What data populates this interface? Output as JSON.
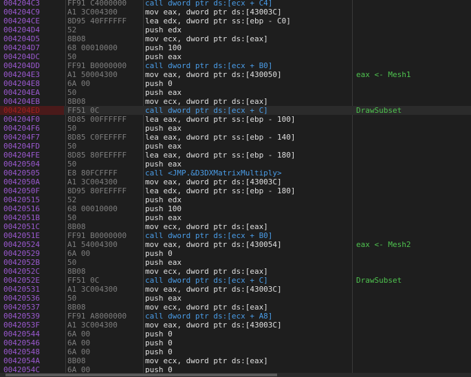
{
  "rows": [
    {
      "addr": "004204C3",
      "bytes": "FF91 C4000000",
      "ins": "call dword ptr ds:[ecx + C4]",
      "comment": "",
      "kind": "call"
    },
    {
      "addr": "004204C9",
      "bytes": "A1 3C004300",
      "ins": "mov eax, dword ptr ds:[43003C]",
      "comment": "",
      "kind": ""
    },
    {
      "addr": "004204CE",
      "bytes": "8D95 40FFFFFF",
      "ins": "lea edx, dword ptr ss:[ebp - C0]",
      "comment": "",
      "kind": ""
    },
    {
      "addr": "004204D4",
      "bytes": "52",
      "ins": "push edx",
      "comment": "",
      "kind": ""
    },
    {
      "addr": "004204D5",
      "bytes": "8B08",
      "ins": "mov ecx, dword ptr ds:[eax]",
      "comment": "",
      "kind": ""
    },
    {
      "addr": "004204D7",
      "bytes": "68 00010000",
      "ins": "push 100",
      "comment": "",
      "kind": ""
    },
    {
      "addr": "004204DC",
      "bytes": "50",
      "ins": "push eax",
      "comment": "",
      "kind": ""
    },
    {
      "addr": "004204DD",
      "bytes": "FF91 B0000000",
      "ins": "call dword ptr ds:[ecx + B0]",
      "comment": "",
      "kind": "call"
    },
    {
      "addr": "004204E3",
      "bytes": "A1 50004300",
      "ins": "mov eax, dword ptr ds:[430050]",
      "comment": "eax <- Mesh1",
      "kind": ""
    },
    {
      "addr": "004204E8",
      "bytes": "6A 00",
      "ins": "push 0",
      "comment": "",
      "kind": ""
    },
    {
      "addr": "004204EA",
      "bytes": "50",
      "ins": "push eax",
      "comment": "",
      "kind": ""
    },
    {
      "addr": "004204EB",
      "bytes": "8B08",
      "ins": "mov ecx, dword ptr ds:[eax]",
      "comment": "",
      "kind": ""
    },
    {
      "addr": "004204ED",
      "bytes": "FF51 0C",
      "ins": "call dword ptr ds:[ecx + C]",
      "comment": "DrawSubset",
      "kind": "call current"
    },
    {
      "addr": "004204F0",
      "bytes": "8D85 00FFFFFF",
      "ins": "lea eax, dword ptr ss:[ebp - 100]",
      "comment": "",
      "kind": ""
    },
    {
      "addr": "004204F6",
      "bytes": "50",
      "ins": "push eax",
      "comment": "",
      "kind": ""
    },
    {
      "addr": "004204F7",
      "bytes": "8D85 C0FEFFFF",
      "ins": "lea eax, dword ptr ss:[ebp - 140]",
      "comment": "",
      "kind": ""
    },
    {
      "addr": "004204FD",
      "bytes": "50",
      "ins": "push eax",
      "comment": "",
      "kind": ""
    },
    {
      "addr": "004204FE",
      "bytes": "8D85 80FEFFFF",
      "ins": "lea eax, dword ptr ss:[ebp - 180]",
      "comment": "",
      "kind": ""
    },
    {
      "addr": "00420504",
      "bytes": "50",
      "ins": "push eax",
      "comment": "",
      "kind": ""
    },
    {
      "addr": "00420505",
      "bytes": "E8 80FCFFFF",
      "ins": "call <JMP.&D3DXMatrixMultiply>",
      "comment": "",
      "kind": "call"
    },
    {
      "addr": "0042050A",
      "bytes": "A1 3C004300",
      "ins": "mov eax, dword ptr ds:[43003C]",
      "comment": "",
      "kind": ""
    },
    {
      "addr": "0042050F",
      "bytes": "8D95 80FEFFFF",
      "ins": "lea edx, dword ptr ss:[ebp - 180]",
      "comment": "",
      "kind": ""
    },
    {
      "addr": "00420515",
      "bytes": "52",
      "ins": "push edx",
      "comment": "",
      "kind": ""
    },
    {
      "addr": "00420516",
      "bytes": "68 00010000",
      "ins": "push 100",
      "comment": "",
      "kind": ""
    },
    {
      "addr": "0042051B",
      "bytes": "50",
      "ins": "push eax",
      "comment": "",
      "kind": ""
    },
    {
      "addr": "0042051C",
      "bytes": "8B08",
      "ins": "mov ecx, dword ptr ds:[eax]",
      "comment": "",
      "kind": ""
    },
    {
      "addr": "0042051E",
      "bytes": "FF91 B0000000",
      "ins": "call dword ptr ds:[ecx + B0]",
      "comment": "",
      "kind": "call"
    },
    {
      "addr": "00420524",
      "bytes": "A1 54004300",
      "ins": "mov eax, dword ptr ds:[430054]",
      "comment": "eax <- Mesh2",
      "kind": ""
    },
    {
      "addr": "00420529",
      "bytes": "6A 00",
      "ins": "push 0",
      "comment": "",
      "kind": ""
    },
    {
      "addr": "0042052B",
      "bytes": "50",
      "ins": "push eax",
      "comment": "",
      "kind": ""
    },
    {
      "addr": "0042052C",
      "bytes": "8B08",
      "ins": "mov ecx, dword ptr ds:[eax]",
      "comment": "",
      "kind": ""
    },
    {
      "addr": "0042052E",
      "bytes": "FF51 0C",
      "ins": "call dword ptr ds:[ecx + C]",
      "comment": "DrawSubset",
      "kind": "call"
    },
    {
      "addr": "00420531",
      "bytes": "A1 3C004300",
      "ins": "mov eax, dword ptr ds:[43003C]",
      "comment": "",
      "kind": ""
    },
    {
      "addr": "00420536",
      "bytes": "50",
      "ins": "push eax",
      "comment": "",
      "kind": ""
    },
    {
      "addr": "00420537",
      "bytes": "8B08",
      "ins": "mov ecx, dword ptr ds:[eax]",
      "comment": "",
      "kind": ""
    },
    {
      "addr": "00420539",
      "bytes": "FF91 A8000000",
      "ins": "call dword ptr ds:[ecx + A8]",
      "comment": "",
      "kind": "call"
    },
    {
      "addr": "0042053F",
      "bytes": "A1 3C004300",
      "ins": "mov eax, dword ptr ds:[43003C]",
      "comment": "",
      "kind": ""
    },
    {
      "addr": "00420544",
      "bytes": "6A 00",
      "ins": "push 0",
      "comment": "",
      "kind": ""
    },
    {
      "addr": "00420546",
      "bytes": "6A 00",
      "ins": "push 0",
      "comment": "",
      "kind": ""
    },
    {
      "addr": "00420548",
      "bytes": "6A 00",
      "ins": "push 0",
      "comment": "",
      "kind": ""
    },
    {
      "addr": "0042054A",
      "bytes": "8B08",
      "ins": "mov ecx, dword ptr ds:[eax]",
      "comment": "",
      "kind": ""
    },
    {
      "addr": "0042054C",
      "bytes": "6A 00",
      "ins": "push 0",
      "comment": "",
      "kind": ""
    }
  ]
}
